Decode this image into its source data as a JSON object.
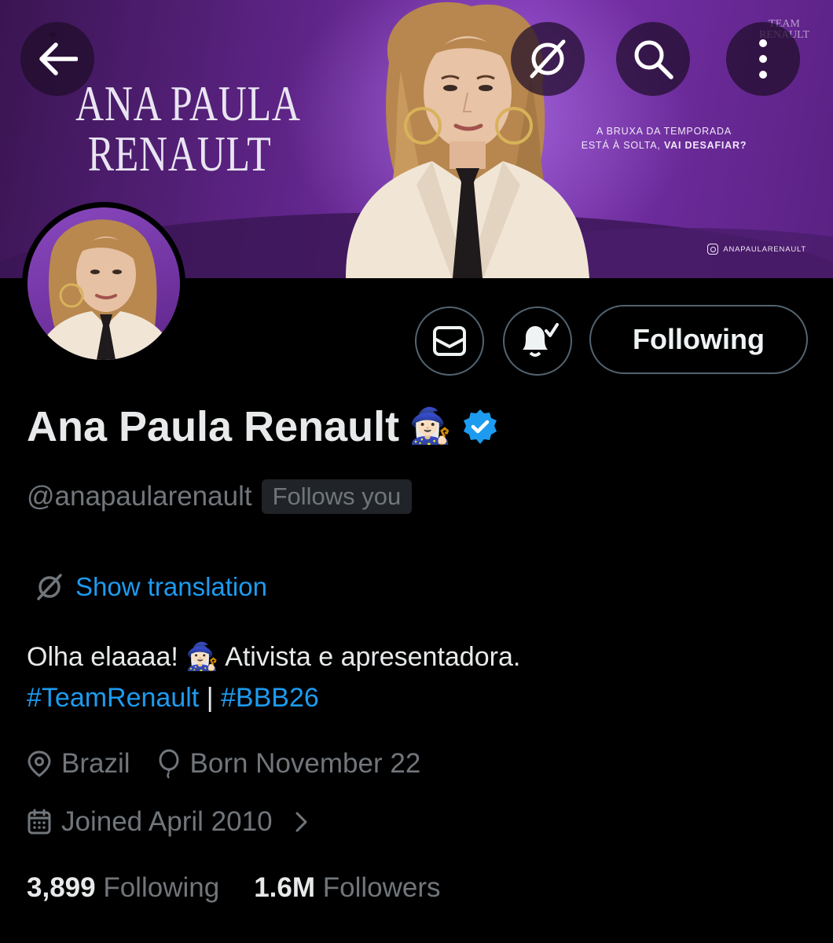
{
  "banner": {
    "name_line1": "ANA PAULA",
    "name_line2": "RENAULT",
    "tagline_line1": "A BRUXA DA TEMPORADA",
    "tagline_line2": "ESTÁ À SOLTA,",
    "tagline_strong": "VAI DESAFIAR?",
    "instagram": "ANAPAULARENAULT",
    "team_logo_line1": "TEAM",
    "team_logo_line2": "RENAULT",
    "colors": {
      "primary": "#5e2487",
      "dark": "#3b1656"
    }
  },
  "topbar": {
    "back_icon": "arrow-left-icon",
    "translate_icon": "no-translate-icon",
    "search_icon": "search-icon",
    "more_icon": "more-vertical-icon"
  },
  "actions": {
    "message_icon": "envelope-icon",
    "notify_icon": "bell-check-icon",
    "following_label": "Following"
  },
  "profile": {
    "display_name": "Ana Paula Renault",
    "name_emoji": "🧙🏻‍♀️",
    "verified_icon": "verified-badge-icon",
    "handle": "@anapaularenault",
    "follows_you": "Follows you",
    "show_translation": "Show translation",
    "bio_text": "Olha elaaaa!",
    "bio_emoji": "🧙🏻‍♀️",
    "bio_text2": "Ativista e apresentadora.",
    "hashtag1": "#TeamRenault",
    "bio_separator": "|",
    "hashtag2": "#BBB26",
    "location": "Brazil",
    "birthday": "Born November 22",
    "joined": "Joined April 2010",
    "following_count": "3,899",
    "following_label": "Following",
    "followers_count": "1.6M",
    "followers_label": "Followers",
    "colors": {
      "accent": "#1d9bf0",
      "muted": "#71767b",
      "text": "#e7e9ea"
    }
  }
}
